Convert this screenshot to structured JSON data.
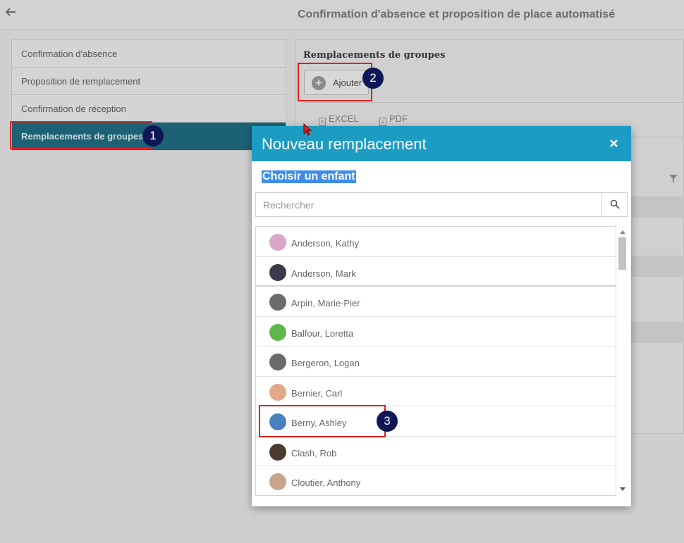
{
  "header": {
    "title": "Confirmation d'absence et proposition de place automatisé"
  },
  "left_menu": {
    "items": [
      {
        "label": "Confirmation d'absence"
      },
      {
        "label": "Proposition de remplacement"
      },
      {
        "label": "Confirmation de réception"
      },
      {
        "label": "Remplacements de groupes",
        "active": true
      }
    ]
  },
  "panel": {
    "title": "Remplacements de groupes",
    "add_label": "Ajouter",
    "excel_label": "EXCEL",
    "pdf_label": "PDF"
  },
  "annotations": [
    "1",
    "2",
    "3"
  ],
  "modal": {
    "title": "Nouveau remplacement",
    "section_label": "Choisir un enfant",
    "search_placeholder": "Rechercher",
    "children": [
      {
        "name": "Anderson, Kathy",
        "avatar_color": "#d8a7c8"
      },
      {
        "name": "Anderson, Mark",
        "avatar_color": "#3a3a4a"
      },
      {
        "name": "Arpin, Marie-Pier",
        "avatar_color": "#6b6b6b"
      },
      {
        "name": "Balfour, Loretta",
        "avatar_color": "#5fb64a"
      },
      {
        "name": "Bergeron, Logan",
        "avatar_color": "#6b6b6b"
      },
      {
        "name": "Bernier, Carl",
        "avatar_color": "#e0a988"
      },
      {
        "name": "Berny, Ashley",
        "avatar_color": "#4a80c0"
      },
      {
        "name": "Clash, Rob",
        "avatar_color": "#4a3a30"
      },
      {
        "name": "Cloutier, Anthony",
        "avatar_color": "#c8a48a"
      }
    ]
  },
  "colors": {
    "accent": "#1d9cc3",
    "active_menu": "#1d6274",
    "annotation_red": "#e02020",
    "annotation_badge": "#0e1656"
  }
}
